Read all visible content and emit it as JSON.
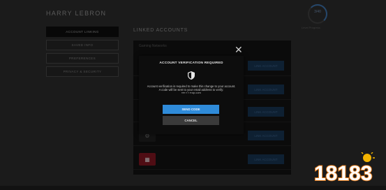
{
  "profile": {
    "name": "HARRY LEBRON",
    "xp_value": "3/40",
    "xp_sub": "Level Progress"
  },
  "sidebar": {
    "items": [
      {
        "label": "ACCOUNT LINKING"
      },
      {
        "label": "SAVED INFO"
      },
      {
        "label": "PREFERENCES"
      },
      {
        "label": "PRIVACY & SECURITY"
      }
    ]
  },
  "linked_accounts": {
    "title": "LINKED ACCOUNTS",
    "gaming_label": "Gaming Networks",
    "rows": [
      {
        "logo": "xbox-logo",
        "text": "",
        "button": "LINK ACCOUNT"
      },
      {
        "logo": "playstation-logo",
        "text": "",
        "button": "LINK ACCOUNT"
      },
      {
        "logo": "psn-logo",
        "text": "",
        "button": "LINK ACCOUNT"
      },
      {
        "logo": "steam-logo",
        "text": "",
        "button": "LINK ACCOUNT"
      },
      {
        "logo": "nintendo-switch-logo",
        "text": "",
        "button": "LINK ACCOUNT"
      }
    ]
  },
  "modal": {
    "title": "ACCOUNT VERIFICATION REQUIRED",
    "icon": "shield-icon",
    "body": "Account verification is required to make this change to your account. A code will be sent to your email address to verify:",
    "email": "▪▪▪▪ ▪ ▪ ▪▪op.com",
    "send_label": "SEND CODE",
    "cancel_label": "CANCEL",
    "close_icon": "close-icon"
  },
  "watermark": {
    "text": "18183"
  },
  "colors": {
    "accent": "#2f8bd9",
    "modal_bg": "#0d0d0d",
    "page_bg": "#2a2a2a"
  }
}
